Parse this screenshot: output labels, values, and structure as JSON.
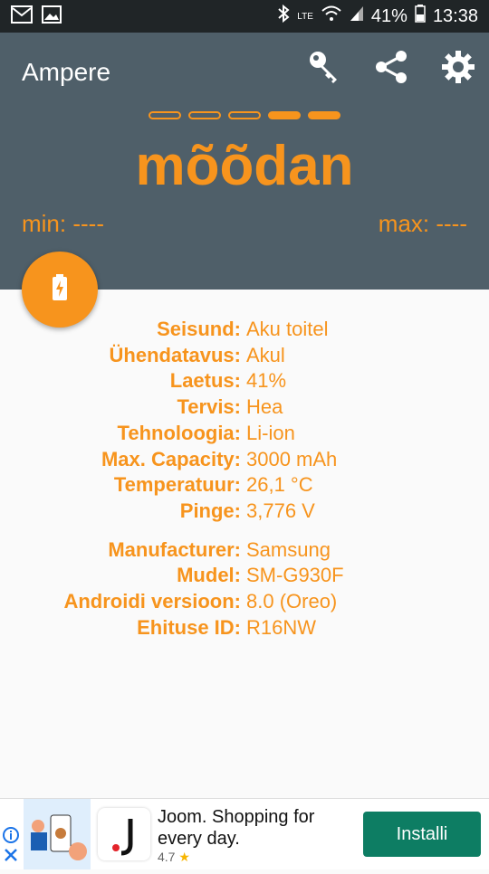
{
  "status_bar": {
    "battery_percent": "41%",
    "time": "13:38",
    "network": "LTE"
  },
  "header": {
    "app_title": "Ampere",
    "icons": [
      "key-icon",
      "share-icon",
      "gear-icon"
    ],
    "progress_dots": {
      "total": 5,
      "filled": 2
    },
    "current_label": "mõõdan",
    "min_label": "min: ----",
    "max_label": "max: ----"
  },
  "fab": {
    "icon": "battery-charging-icon"
  },
  "info_rows": [
    {
      "label": "Seisund:",
      "value": "Aku toitel"
    },
    {
      "label": "Ühendatavus:",
      "value": "Akul"
    },
    {
      "label": "Laetus:",
      "value": "41%"
    },
    {
      "label": "Tervis:",
      "value": "Hea"
    },
    {
      "label": "Tehnoloogia:",
      "value": "Li-ion"
    },
    {
      "label": "Max. Capacity:",
      "value": "3000 mAh"
    },
    {
      "label": "Temperatuur:",
      "value": "26,1 °C"
    },
    {
      "label": "Pinge:",
      "value": "3,776 V"
    }
  ],
  "device_rows": [
    {
      "label": "Manufacturer:",
      "value": "Samsung"
    },
    {
      "label": "Mudel:",
      "value": "SM-G930F"
    },
    {
      "label": "Androidi versioon:",
      "value": "8.0 (Oreo)"
    },
    {
      "label": "Ehituse ID:",
      "value": "R16NW"
    }
  ],
  "ad": {
    "title": "Joom. Shopping for every day.",
    "rating": "4.7",
    "button": "Installi"
  },
  "colors": {
    "accent": "#f7941d",
    "header_bg": "#4f5f69",
    "statusbar_bg": "#202527",
    "install_button": "#0d7d63"
  }
}
